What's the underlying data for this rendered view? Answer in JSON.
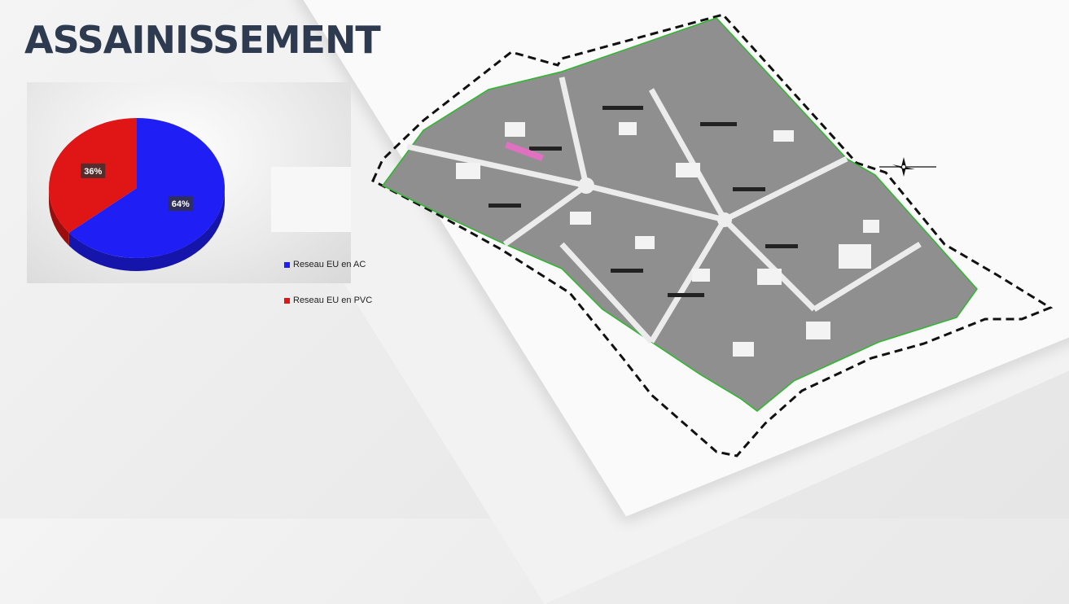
{
  "title": "ASSAINISSEMENT",
  "chart_data": {
    "type": "pie",
    "title": "",
    "categories": [
      "Reseau EU en AC",
      "Reseau EU en PVC"
    ],
    "values": [
      64,
      36
    ],
    "labels": [
      "64%",
      "36%"
    ],
    "colors": [
      "#1f1ff5",
      "#e01515"
    ],
    "legend_position": "right"
  },
  "map": {
    "description_colors": {
      "paper": "#fafafa",
      "blocks": "#8a8a8a",
      "network": "#2db82d",
      "boundary": "#111111"
    }
  }
}
